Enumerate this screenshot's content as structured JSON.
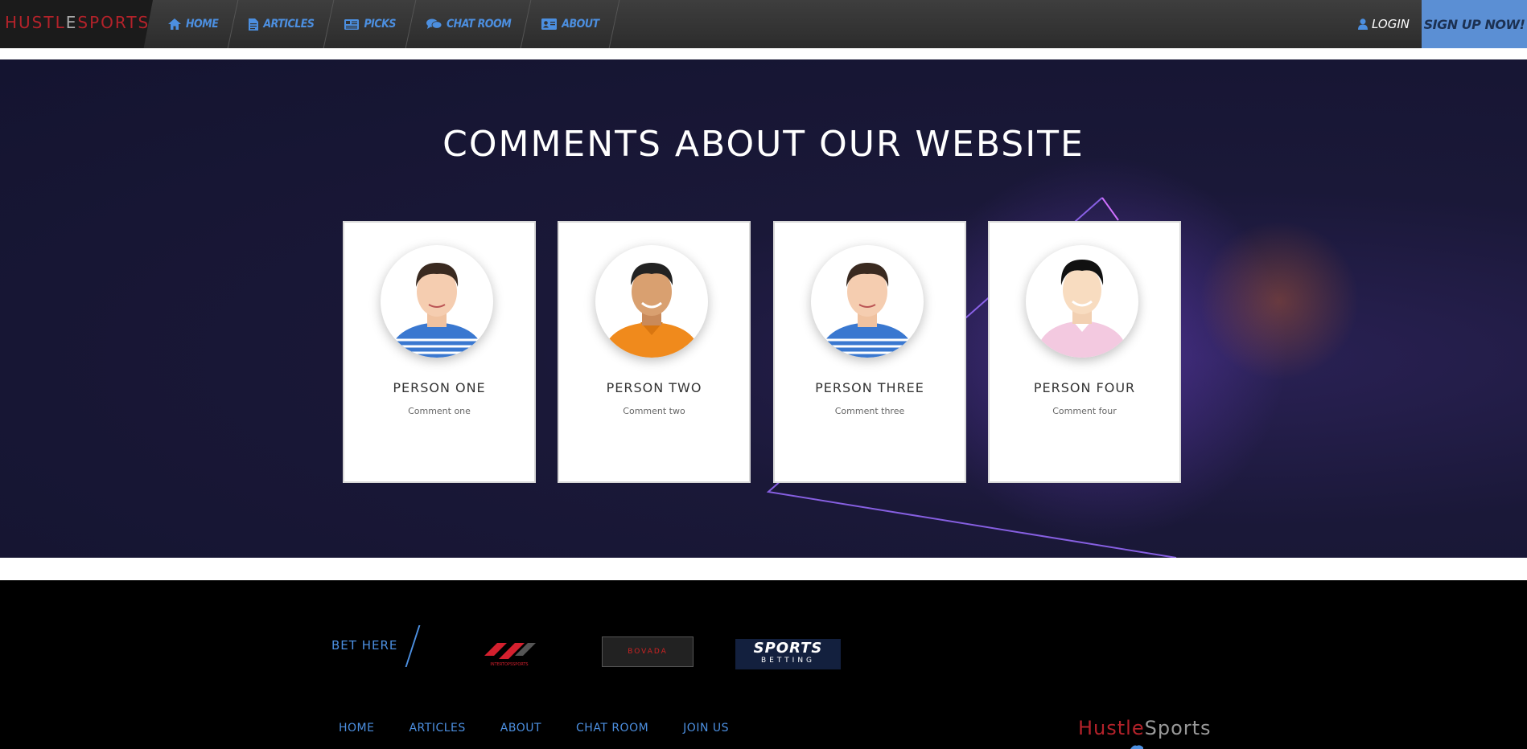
{
  "navbar": {
    "brand": {
      "part1": "HUSTL",
      "part2": "E",
      "part3": "SPORTS"
    },
    "items": [
      {
        "label": "HOME",
        "icon": "home-icon"
      },
      {
        "label": "ARTICLES",
        "icon": "document-icon"
      },
      {
        "label": "PICKS",
        "icon": "newspaper-icon"
      },
      {
        "label": "CHAT ROOM",
        "icon": "chat-icon"
      },
      {
        "label": "ABOUT",
        "icon": "id-card-icon"
      }
    ],
    "login": "LOGIN",
    "signup": "SIGN UP NOW!"
  },
  "comments": {
    "title": "COMMENTS ABOUT OUR WEBSITE",
    "cards": [
      {
        "name": "PERSON ONE",
        "comment": "Comment one",
        "shirt": "#3a78d0"
      },
      {
        "name": "PERSON TWO",
        "comment": "Comment two",
        "shirt": "#f08a1c"
      },
      {
        "name": "PERSON THREE",
        "comment": "Comment three",
        "shirt": "#3a78d0"
      },
      {
        "name": "PERSON FOUR",
        "comment": "Comment four",
        "shirt": "#f3c9e0"
      }
    ]
  },
  "footer": {
    "bet_here": "BET HERE",
    "partners": {
      "intertops": "INTERTOPSSPORTS",
      "bovada": "BOVADA",
      "sportsbetting_line1": "SPORTS",
      "sportsbetting_line2": "BETTING"
    },
    "nav": [
      "HOME",
      "ARTICLES",
      "ABOUT",
      "CHAT ROOM",
      "JOIN US"
    ],
    "brand": {
      "hustle": "Hustle",
      "sports": "Sports"
    }
  },
  "colors": {
    "accent_blue": "#4c8fe0",
    "brand_red": "#b3222a",
    "signup_bg": "#5b8fd4"
  }
}
